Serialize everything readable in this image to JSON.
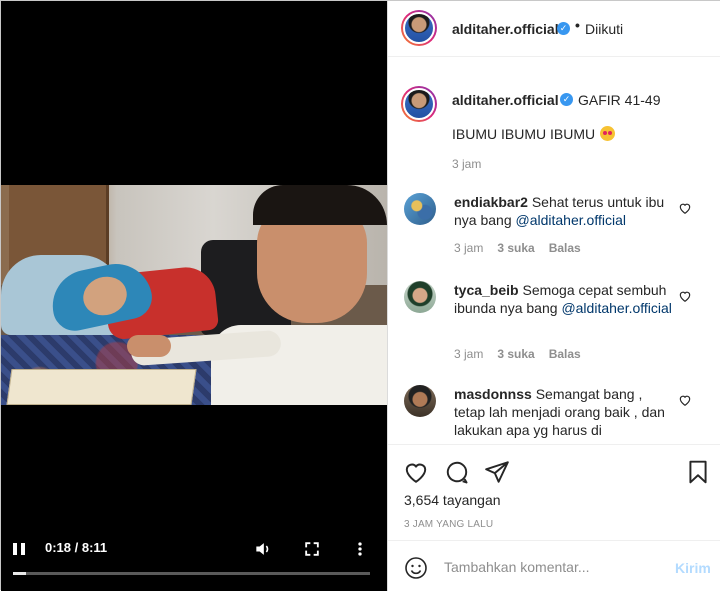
{
  "video": {
    "time_display": "0:18 / 8:11",
    "progress_fraction": 0.037
  },
  "post": {
    "username": "alditaher.official",
    "follow_state": "Diikuti",
    "accent_color": "#3897f0"
  },
  "caption": {
    "username": "alditaher.official",
    "tag": "GAFIR 41-49",
    "text": "IBUMU IBUMU IBUMU",
    "emoji": "smiling-face-with-heart-eyes",
    "time": "3 jam"
  },
  "comments": [
    {
      "username": "endiakbar2",
      "text": "Sehat terus untuk ibu nya bang",
      "mention": "@alditaher.official",
      "time": "3 jam",
      "likes": "3 suka",
      "reply": "Balas"
    },
    {
      "username": "tyca_beib",
      "text": "Semoga cepat sembuh ibunda nya bang",
      "mention": "@alditaher.official",
      "time": "3 jam",
      "likes": "3 suka",
      "reply": "Balas"
    },
    {
      "username": "masdonnss",
      "text": "Semangat bang , tetap lah menjadi orang baik , dan lakukan apa yg harus di",
      "mention": "",
      "time": "",
      "likes": "",
      "reply": ""
    }
  ],
  "stats": {
    "views": "3,654 tayangan",
    "posted": "3 JAM YANG LALU"
  },
  "comment_box": {
    "placeholder": "Tambahkan komentar...",
    "post_label": "Kirim"
  }
}
